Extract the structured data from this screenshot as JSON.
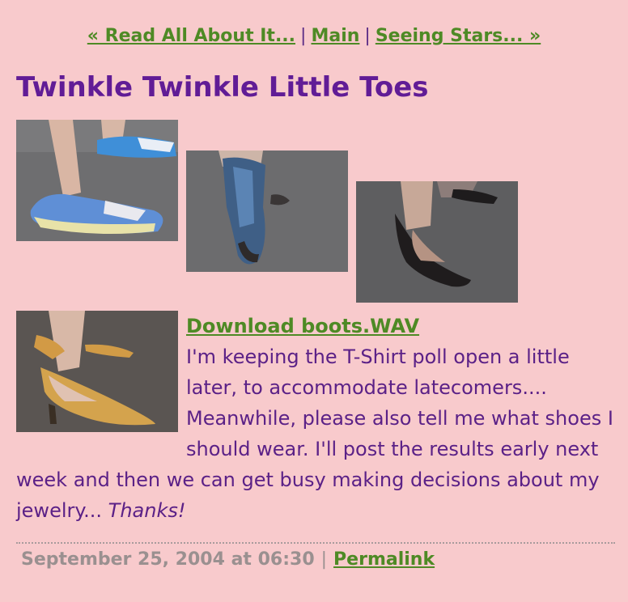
{
  "nav": {
    "prev_label": "« Read All About It...",
    "main_label": "Main",
    "next_label": "Seeing Stars... »",
    "separator": "|"
  },
  "post": {
    "title": "Twinkle Twinkle Little Toes",
    "download_label": "Download boots.WAV",
    "body": "I'm keeping the T-Shirt poll open a little later, to accommodate latecomers.... Meanwhile, please also tell me what shoes I should wear. I'll post the results early next week and then we can get busy making decisions about my jewelry... ",
    "body_emphasis": "Thanks!"
  },
  "footer": {
    "timestamp": "September 25, 2004 at 06:30",
    "separator": "|",
    "permalink_label": "Permalink"
  },
  "colors": {
    "background": "#f8cacc",
    "link": "#4e8a25",
    "title": "#611c96",
    "text": "#5b2187",
    "meta": "#9a9090"
  },
  "photos": [
    {
      "subject": "blue-sneakers"
    },
    {
      "subject": "blue-cowboy-boot"
    },
    {
      "subject": "black-pointed-heels"
    },
    {
      "subject": "tan-pointed-mules"
    }
  ]
}
